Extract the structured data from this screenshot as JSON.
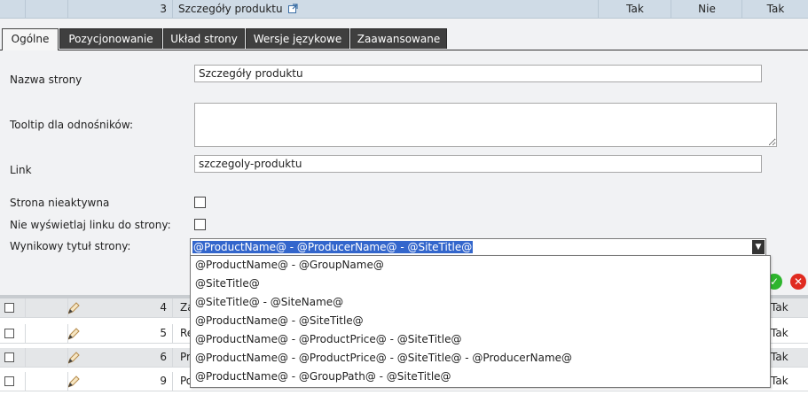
{
  "top_row": {
    "number": "3",
    "title": "Szczegóły produktu",
    "col1": "Tak",
    "col2": "Nie",
    "col3": "Tak"
  },
  "tabs": [
    {
      "label": "Ogólne",
      "active": true
    },
    {
      "label": "Pozycjonowanie"
    },
    {
      "label": "Układ strony"
    },
    {
      "label": "Wersje językowe"
    },
    {
      "label": "Zaawansowane"
    }
  ],
  "form": {
    "page_name_label": "Nazwa strony",
    "page_name_value": "Szczegóły produktu",
    "tooltip_label": "Tooltip dla odnośników:",
    "tooltip_value": "",
    "link_label": "Link",
    "link_value": "szczegoly-produktu",
    "inactive_label": "Strona nieaktywna",
    "hide_link_label": "Nie wyświetlaj linku do strony:",
    "result_title_label": "Wynikowy tytuł strony:",
    "result_title_selected": "@ProductName@ - @ProducerName@ - @SiteTitle@"
  },
  "dropdown_options": [
    "@ProductName@ - @GroupName@",
    "@SiteTitle@",
    "@SiteTitle@ - @SiteName@",
    "@ProductName@ - @SiteTitle@",
    "@ProductName@ - @ProductPrice@ - @SiteTitle@",
    "@ProductName@ - @ProductPrice@ - @SiteTitle@ - @ProducerName@",
    "@ProductName@ - @GroupPath@ - @SiteTitle@"
  ],
  "rows": [
    {
      "number": "4",
      "title": "Za",
      "value": "Tak"
    },
    {
      "number": "5",
      "title": "Re",
      "value": "Tak"
    },
    {
      "number": "6",
      "title": "Pr",
      "value": "Tak"
    },
    {
      "number": "9",
      "title": "Po",
      "value": "Tak"
    }
  ],
  "colors": {
    "accept": "#2db52d",
    "cancel": "#e02b20",
    "selection": "#3366cc"
  }
}
